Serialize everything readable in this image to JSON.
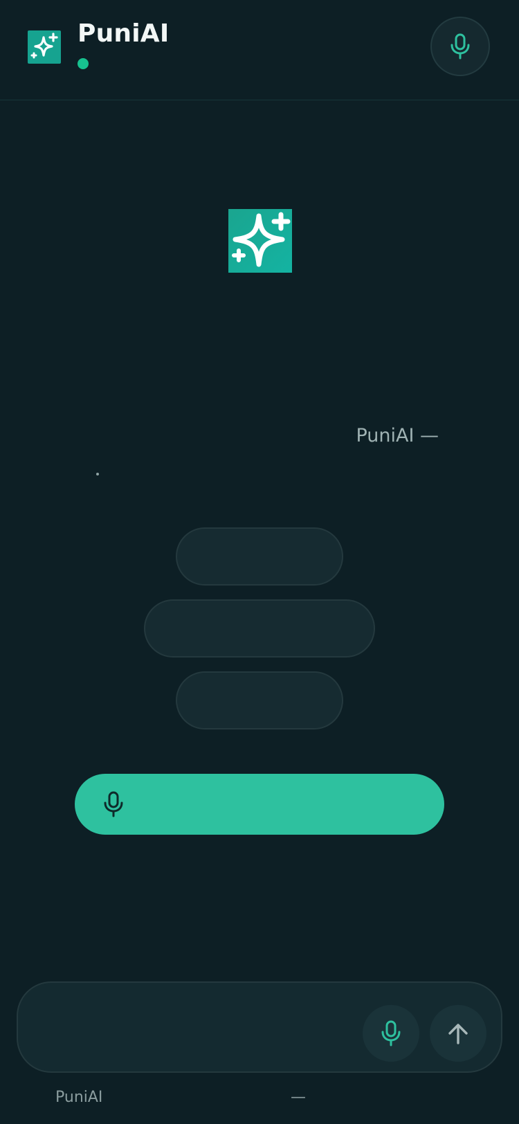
{
  "header": {
    "title": "PuniAI",
    "logo_icon": "sparkle-icon",
    "mic_icon": "microphone-icon",
    "status_color": "#17c18f"
  },
  "hero": {
    "logo_icon": "sparkle-icon",
    "line": "PuniAI —",
    "subline": "."
  },
  "suggestions": [
    {
      "label": ""
    },
    {
      "label": ""
    },
    {
      "label": ""
    }
  ],
  "voice_cta": {
    "icon": "microphone-icon",
    "label": ""
  },
  "composer": {
    "placeholder": "...",
    "mic_icon": "microphone-icon",
    "send_icon": "arrow-up-icon"
  },
  "footer": {
    "left": "PuniAI",
    "right": "—"
  },
  "colors": {
    "background": "#0d1f25",
    "accent": "#2ec19f",
    "brand_tile": "#16a390"
  }
}
